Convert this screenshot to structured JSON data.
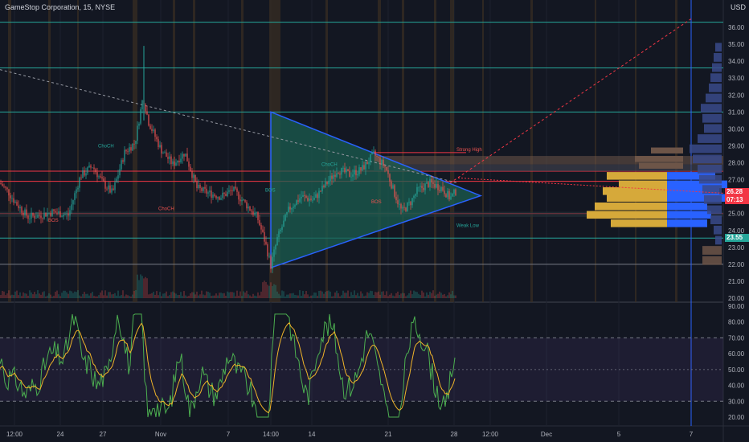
{
  "header": {
    "title": "GameStop Corporation, 15, NYSE",
    "currency": "USD"
  },
  "price_axis": {
    "ticks": [
      "36.00",
      "35.00",
      "34.00",
      "33.00",
      "32.00",
      "31.00",
      "30.00",
      "29.00",
      "28.00",
      "27.00",
      "26.00",
      "25.00",
      "24.00",
      "23.00",
      "22.00",
      "21.00",
      "20.00"
    ],
    "last_price": "26.28",
    "countdown": "07:13",
    "level_badge": "23.55"
  },
  "rsi_axis": {
    "ticks": [
      "90.00",
      "80.00",
      "70.00",
      "60.00",
      "50.00",
      "40.00",
      "30.00",
      "20.00"
    ]
  },
  "time_axis": {
    "ticks": [
      "12:00",
      "24",
      "27",
      "Nov",
      "7",
      "14:00",
      "14",
      "21",
      "28",
      "12:00",
      "Dec",
      "5",
      "7"
    ]
  },
  "annotations": {
    "choch": [
      "ChoCH",
      "ChoCH",
      "ChoCH"
    ],
    "bos": [
      "BOS",
      "BOS",
      "BOS"
    ],
    "strong_high": "Strong High",
    "weak_low": "Weak Low"
  },
  "colors": {
    "background": "#131722",
    "up": "#26a69a",
    "down": "#ef5350",
    "rsi": "#4caf50",
    "rsi_ma": "#f0b429",
    "triangle_line": "#2962ff",
    "triangle_fill": "#1b5e50",
    "level_red": "#f23645",
    "level_green": "#26a69a",
    "vp_gold": "#d6a93a",
    "vp_blue": "#2962ff",
    "vp_brown": "#6d5548"
  }
}
